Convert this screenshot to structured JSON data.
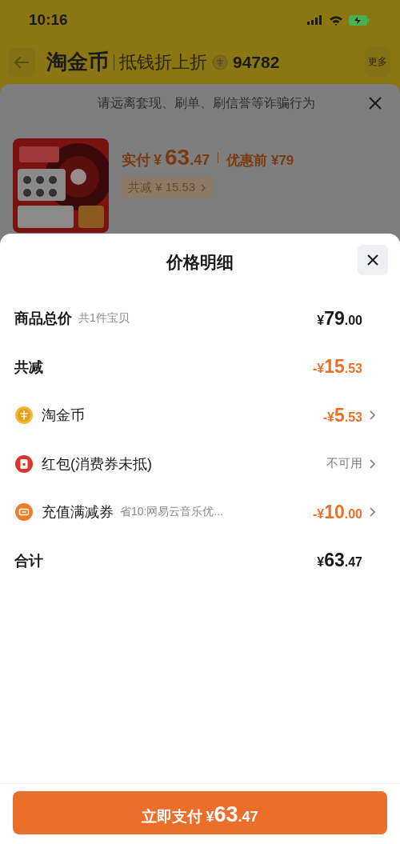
{
  "status_bar": {
    "time": "10:16"
  },
  "header": {
    "brand": "淘金币",
    "subtitle": "抵钱折上折",
    "coins": "94782",
    "more": "更多"
  },
  "notice_sheet": {
    "notice": "请远离套现、刷单、刷信誉等诈骗行为",
    "product": {
      "kind": "picture",
      "paid_label": "实付",
      "paid_currency": "¥",
      "paid_integer": "63",
      "paid_decimal": ".47",
      "before_label": "优惠前",
      "before_price": "¥79",
      "discount_chip": "共减 ¥ 15.53"
    }
  },
  "detail_sheet": {
    "title": "价格明细",
    "rows": [
      {
        "kind": "plain",
        "label": "商品总价",
        "note": "共1件宝贝",
        "color": "#1a1a1a",
        "currency": "¥",
        "integer": "79",
        "decimal": ".00",
        "arrow": false
      },
      {
        "kind": "plain",
        "label": "共减",
        "color": "#ee6f26",
        "currency": "-¥",
        "integer": "15",
        "decimal": ".53",
        "arrow": false
      },
      {
        "kind": "coin",
        "label": "淘金币",
        "color": "#ee6f26",
        "currency": "-¥",
        "integer": "5",
        "decimal": ".53",
        "arrow": true
      },
      {
        "kind": "red_packet",
        "label": "红包(消费券未抵)",
        "color": "#7a7a7a",
        "text_value": "不可用",
        "arrow": true
      },
      {
        "kind": "coupon",
        "label": "充值满减券",
        "note": "省10:网易云音乐优...",
        "color": "#ee6f26",
        "currency": "-¥",
        "integer": "10",
        "decimal": ".00",
        "arrow": true
      },
      {
        "kind": "plain",
        "label": "合计",
        "color": "#1a1a1a",
        "currency": "¥",
        "integer": "63",
        "decimal": ".47",
        "arrow": false
      }
    ]
  },
  "pay_button": {
    "label": "立即支付",
    "currency": "¥",
    "integer": "63",
    "decimal": ".47"
  }
}
